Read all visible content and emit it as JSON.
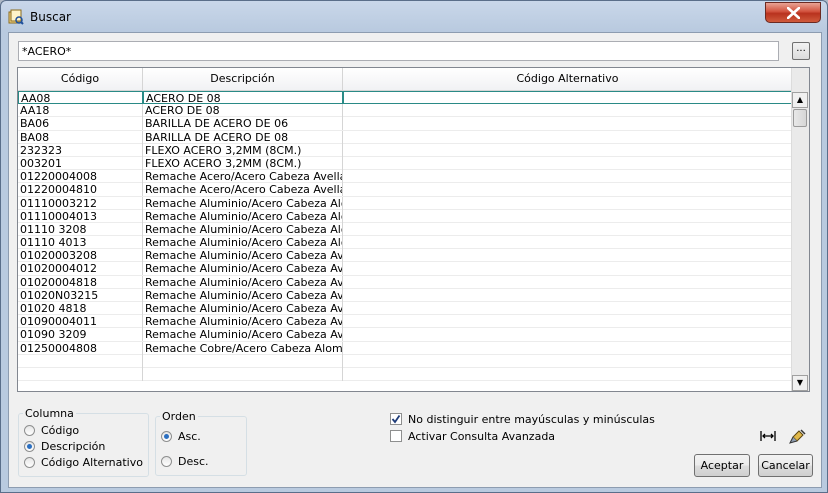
{
  "window": {
    "title": "Buscar"
  },
  "search": {
    "value": "*ACERO*",
    "browse_label": "..."
  },
  "grid": {
    "columns": [
      "Código",
      "Descripción",
      "Código Alternativo"
    ],
    "rows": [
      [
        "AA08",
        "ACERO DE 08",
        ""
      ],
      [
        "AA18",
        "ACERO DE 08",
        ""
      ],
      [
        "BA06",
        "BARILLA DE ACERO DE 06",
        ""
      ],
      [
        "BA08",
        "BARILLA DE ACERO DE 08",
        ""
      ],
      [
        "232323",
        "FLEXO ACERO 3,2MM (8CM.)",
        ""
      ],
      [
        "003201",
        "FLEXO ACERO 3,2MM (8CM.)",
        ""
      ],
      [
        "01220004008",
        "Remache Acero/Acero Cabeza Avellanad",
        ""
      ],
      [
        "01220004810",
        "Remache Acero/Acero Cabeza Avellanad",
        ""
      ],
      [
        "01110003212",
        "Remache Aluminio/Acero Cabeza Alomad",
        ""
      ],
      [
        "01110004013",
        "Remache Aluminio/Acero Cabeza Alomad",
        ""
      ],
      [
        "01110 3208",
        "Remache Aluminio/Acero Cabeza Alomad",
        ""
      ],
      [
        "01110 4013",
        "Remache Aluminio/Acero Cabeza Alomad",
        ""
      ],
      [
        "01020003208",
        "Remache Aluminio/Acero Cabeza Avellan",
        ""
      ],
      [
        "01020004012",
        "Remache Aluminio/Acero Cabeza Avellan",
        ""
      ],
      [
        "01020004818",
        "Remache Aluminio/Acero Cabeza Avellan",
        ""
      ],
      [
        "01020N03215",
        "Remache Aluminio/Acero Cabeza Avellan",
        ""
      ],
      [
        "01020 4818",
        "Remache Aluminio/Acero Cabeza Avellan",
        ""
      ],
      [
        "01090004011",
        "Remache Aluminio/Acero Cabeza Avellan",
        ""
      ],
      [
        "01090 3209",
        "Remache Aluminio/Acero Cabeza Avellan",
        ""
      ],
      [
        "01250004808",
        "Remache Cobre/Acero Cabeza Alomada",
        ""
      ],
      [
        "",
        "",
        ""
      ],
      [
        "",
        "",
        ""
      ]
    ]
  },
  "columna": {
    "legend": "Columna",
    "options": [
      "Código",
      "Descripción",
      "Código Alternativo"
    ],
    "selected": 1
  },
  "orden": {
    "legend": "Orden",
    "options": [
      "Asc.",
      "Desc."
    ],
    "selected": 0
  },
  "options": {
    "case_insensitive": {
      "label": "No distinguir entre mayúsculas y minúsculas",
      "checked": true
    },
    "advanced": {
      "label": "Activar Consulta Avanzada",
      "checked": false
    }
  },
  "buttons": {
    "accept": "Aceptar",
    "cancel": "Cancelar"
  },
  "icons": {
    "app": "search-table-icon",
    "fit_columns": "fit-columns-icon",
    "clear": "clear-brush-icon"
  }
}
